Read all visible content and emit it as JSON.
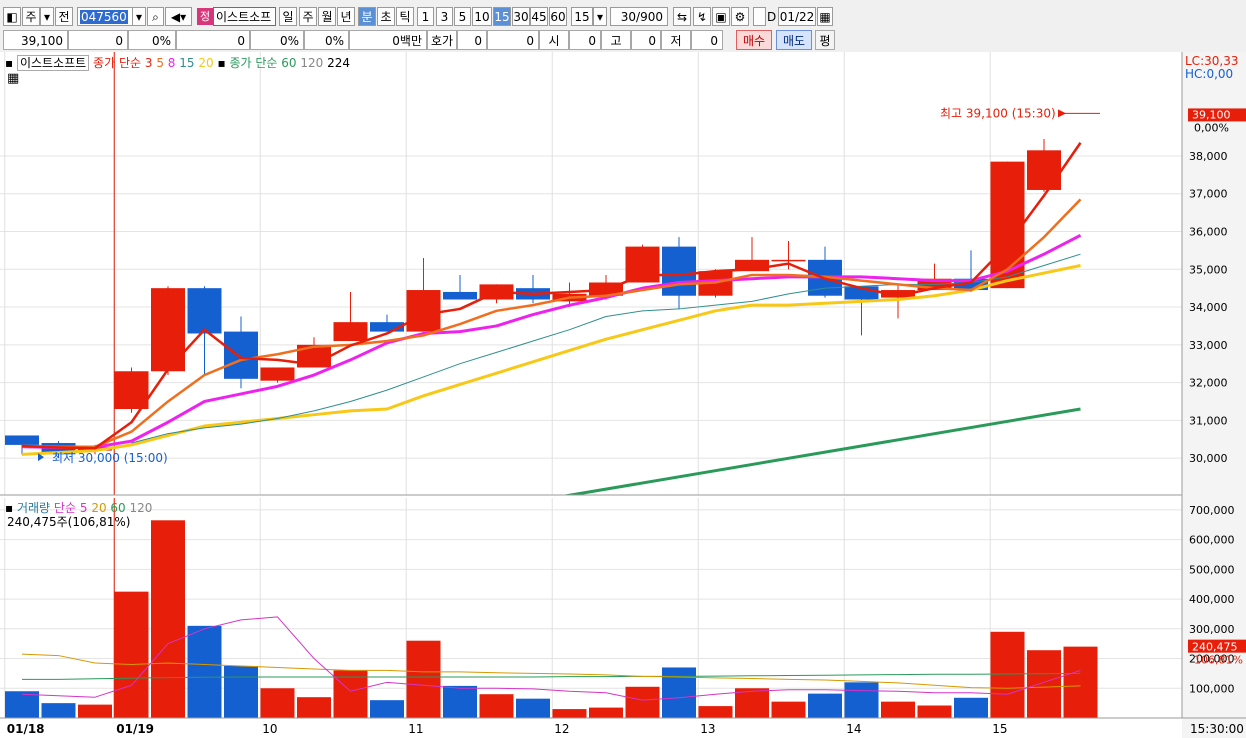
{
  "toolbar": {
    "market": "주",
    "prev": "전",
    "code": "047560",
    "grade": "정",
    "name": "이스트소프",
    "periods": [
      "일",
      "주",
      "월",
      "년",
      "분",
      "초",
      "틱"
    ],
    "active_period": "분",
    "intervals": [
      "1",
      "3",
      "5",
      "10",
      "15",
      "30",
      "45",
      "60"
    ],
    "active_interval": "15",
    "interval_select": "15",
    "count": "30/900",
    "date": "01/22",
    "date_check": "D"
  },
  "info": {
    "price": "39,100",
    "change": "0",
    "change_pct": "0%",
    "volume": "0",
    "vol_pct": "0%",
    "pct2": "0%",
    "amount": "0백만",
    "hoga_label": "호가",
    "hoga": "0",
    "hoga2": "0",
    "open_label": "시",
    "open": "0",
    "high_label": "고",
    "high": "0",
    "low_label": "저",
    "low": "0",
    "buy": "매수",
    "sell": "매도",
    "flat": "평"
  },
  "colors": {
    "up": "#e61e0a",
    "down": "#1560d0",
    "ma3": "#e61e0a",
    "ma5": "#ef6f1e",
    "ma8": "#ee22ee",
    "ma15": "#2f8f8f",
    "ma20": "#f7c816",
    "ma60": "#2a9a5a",
    "vma5": "#d633c8",
    "vma20": "#d69a00",
    "vma60": "#2a9a5a"
  },
  "chart_data": [
    {
      "type": "candlestick",
      "title": "이스트소프트",
      "legend": {
        "label": "종가 단순",
        "periods": [
          "3",
          "5",
          "8",
          "15",
          "20"
        ],
        "label2": "종가 단순",
        "periods2": [
          "60",
          "120",
          "224"
        ]
      },
      "lc": "LC:30,33",
      "hc": "HC:0,00",
      "last_price_label": "39,100",
      "last_change_label": "0,00%",
      "high_marker": "최고 39,100 (15:30)",
      "low_marker": "최저 30,000 (15:00)",
      "ylim": [
        29050,
        40700
      ],
      "yticks": [
        30000,
        31000,
        32000,
        33000,
        34000,
        35000,
        36000,
        37000,
        38000
      ],
      "ytick_labels": [
        "30,000",
        "31,000",
        "32,000",
        "33,000",
        "34,000",
        "35,000",
        "36,000",
        "37,000",
        "38,000"
      ],
      "candles": [
        {
          "o": 30600,
          "h": 30600,
          "l": 30100,
          "c": 30350
        },
        {
          "o": 30400,
          "h": 30450,
          "l": 30000,
          "c": 30100
        },
        {
          "o": 30200,
          "h": 30350,
          "l": 30100,
          "c": 30300
        },
        {
          "o": 31300,
          "h": 32400,
          "l": 31200,
          "c": 32300
        },
        {
          "o": 32300,
          "h": 34550,
          "l": 32200,
          "c": 34500
        },
        {
          "o": 34500,
          "h": 34550,
          "l": 32200,
          "c": 33300
        },
        {
          "o": 33350,
          "h": 33750,
          "l": 31850,
          "c": 32100
        },
        {
          "o": 32050,
          "h": 32400,
          "l": 32000,
          "c": 32400
        },
        {
          "o": 32400,
          "h": 33200,
          "l": 32400,
          "c": 33000
        },
        {
          "o": 33100,
          "h": 34400,
          "l": 33100,
          "c": 33600
        },
        {
          "o": 33600,
          "h": 33800,
          "l": 33350,
          "c": 33350
        },
        {
          "o": 33350,
          "h": 35300,
          "l": 33350,
          "c": 34450
        },
        {
          "o": 34400,
          "h": 34850,
          "l": 34200,
          "c": 34200
        },
        {
          "o": 34200,
          "h": 34600,
          "l": 34100,
          "c": 34600
        },
        {
          "o": 34500,
          "h": 34850,
          "l": 34100,
          "c": 34200
        },
        {
          "o": 34150,
          "h": 34650,
          "l": 34000,
          "c": 34350
        },
        {
          "o": 34300,
          "h": 34850,
          "l": 34200,
          "c": 34650
        },
        {
          "o": 34650,
          "h": 35650,
          "l": 34650,
          "c": 35600
        },
        {
          "o": 35600,
          "h": 35850,
          "l": 33950,
          "c": 34300
        },
        {
          "o": 34300,
          "h": 35000,
          "l": 34250,
          "c": 34950
        },
        {
          "o": 34950,
          "h": 35850,
          "l": 34950,
          "c": 35250
        },
        {
          "o": 35250,
          "h": 35750,
          "l": 35000,
          "c": 35250
        },
        {
          "o": 35250,
          "h": 35600,
          "l": 34250,
          "c": 34300
        },
        {
          "o": 34550,
          "h": 34550,
          "l": 33250,
          "c": 34200
        },
        {
          "o": 34250,
          "h": 34600,
          "l": 33700,
          "c": 34450
        },
        {
          "o": 34450,
          "h": 35150,
          "l": 34450,
          "c": 34750
        },
        {
          "o": 34750,
          "h": 35500,
          "l": 34400,
          "c": 34450
        },
        {
          "o": 34500,
          "h": 37850,
          "l": 34500,
          "c": 37850
        },
        {
          "o": 37100,
          "h": 38450,
          "l": 37050,
          "c": 38150
        }
      ],
      "ma3": [
        30320,
        30280,
        30260,
        30950,
        32350,
        33400,
        32650,
        32600,
        32480,
        32980,
        33300,
        33800,
        33950,
        34400,
        34350,
        34400,
        34450,
        34850,
        34850,
        34950,
        35000,
        35150,
        34750,
        34500,
        34300,
        34500,
        34650,
        35650,
        36950,
        38350
      ],
      "ma5": [
        30320,
        30300,
        30300,
        30700,
        31500,
        32200,
        32600,
        32750,
        32950,
        33000,
        33100,
        33250,
        33550,
        33900,
        34050,
        34250,
        34300,
        34450,
        34600,
        34650,
        34850,
        34850,
        34800,
        34700,
        34600,
        34500,
        34450,
        35000,
        35850,
        36850
      ],
      "ma8": [
        30300,
        30280,
        30290,
        30450,
        30950,
        31500,
        31700,
        31900,
        32200,
        32600,
        33050,
        33300,
        33350,
        33500,
        33800,
        34050,
        34250,
        34500,
        34650,
        34700,
        34750,
        34800,
        34800,
        34800,
        34750,
        34700,
        34700,
        34950,
        35400,
        35900
      ],
      "ma15": [
        null,
        null,
        null,
        30400,
        30650,
        30800,
        30900,
        31050,
        31250,
        31500,
        31800,
        32150,
        32500,
        32800,
        33100,
        33400,
        33750,
        33900,
        33950,
        34050,
        34150,
        34350,
        34500,
        34550,
        34600,
        34600,
        34650,
        34800,
        35100,
        35400
      ],
      "ma20": [
        30100,
        30150,
        30200,
        30350,
        30600,
        30850,
        30950,
        31050,
        31150,
        31250,
        31300,
        31650,
        31950,
        32250,
        32550,
        32850,
        33150,
        33400,
        33650,
        33900,
        34050,
        34050,
        34100,
        34150,
        34200,
        34300,
        34450,
        34700,
        34900,
        35100
      ],
      "ma60_x": [
        14.9,
        29
      ],
      "ma60": [
        29000,
        31300
      ],
      "volume_legend": {
        "label": "거래량",
        "label2": "단순",
        "periods": [
          "5",
          "20",
          "60",
          "120"
        ],
        "current": "240,475주(106,81%)"
      },
      "volume_last_label": "240,475",
      "volume_last_pct": "106,81%",
      "volume_ylim": [
        0,
        740000
      ],
      "volume_yticks": [
        100000,
        200000,
        300000,
        400000,
        500000,
        600000,
        700000
      ],
      "volume_ytick_labels": [
        "100,000",
        "200,000",
        "300,000",
        "400,000",
        "500,000",
        "600,000",
        "700,000"
      ],
      "volume": [
        90000,
        50000,
        45000,
        425000,
        665000,
        310000,
        175000,
        100000,
        70000,
        160000,
        60000,
        260000,
        108000,
        80000,
        65000,
        30000,
        35000,
        105000,
        170000,
        40000,
        100000,
        55000,
        82000,
        120000,
        55000,
        42000,
        68000,
        290000,
        228000,
        240000
      ],
      "vma5": [
        80000,
        75000,
        70000,
        110000,
        250000,
        300000,
        330000,
        340000,
        200000,
        90000,
        120000,
        110000,
        100000,
        100000,
        98000,
        90000,
        85000,
        60000,
        68000,
        80000,
        90000,
        95000,
        95000,
        92000,
        90000,
        85000,
        85000,
        80000,
        120000,
        160000
      ],
      "vma20": [
        215000,
        210000,
        185000,
        180000,
        185000,
        180000,
        175000,
        170000,
        165000,
        160000,
        160000,
        155000,
        155000,
        152000,
        150000,
        148000,
        145000,
        140000,
        138000,
        135000,
        133000,
        130000,
        128000,
        123000,
        118000,
        110000,
        102000,
        100000,
        104000,
        108000
      ],
      "vma60": [
        130000,
        130000,
        132000,
        134000,
        136000,
        137000,
        138000,
        138000,
        138000,
        138000,
        138000,
        138000,
        138000,
        138000,
        138000,
        139000,
        139000,
        140000,
        140000,
        141000,
        142000,
        143000,
        144000,
        145000,
        146000,
        147000,
        147000,
        148000,
        149000,
        150000
      ],
      "x_labels": [
        {
          "i": 0,
          "text": "01/18"
        },
        {
          "i": 3,
          "text": "01/19"
        },
        {
          "i": 7,
          "text": "10"
        },
        {
          "i": 11,
          "text": "11"
        },
        {
          "i": 15,
          "text": "12"
        },
        {
          "i": 19,
          "text": "13"
        },
        {
          "i": 23,
          "text": "14"
        },
        {
          "i": 27,
          "text": "15"
        }
      ],
      "x_right_label": "15:30:00"
    }
  ]
}
